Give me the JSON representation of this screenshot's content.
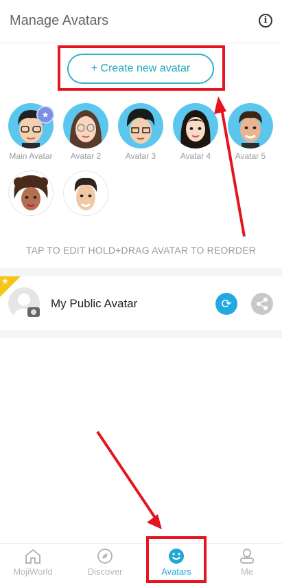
{
  "header": {
    "title": "Manage Avatars",
    "info_icon": "info-circle-icon"
  },
  "create_button": {
    "label": "+ Create new avatar"
  },
  "avatars": [
    {
      "label": "Main Avatar",
      "is_main": true
    },
    {
      "label": "Avatar 2"
    },
    {
      "label": "Avatar 3"
    },
    {
      "label": "Avatar 4"
    },
    {
      "label": "Avatar 5"
    },
    {
      "label": ""
    },
    {
      "label": ""
    }
  ],
  "hint": "TAP TO EDIT HOLD+DRAG AVATAR TO REORDER",
  "public_avatar": {
    "name": "My Public Avatar"
  },
  "nav": {
    "items": [
      {
        "label": "MojiWorld",
        "icon": "home-icon"
      },
      {
        "label": "Discover",
        "icon": "compass-icon"
      },
      {
        "label": "Avatars",
        "icon": "smiley-icon",
        "active": true
      },
      {
        "label": "Me",
        "icon": "person-icon"
      }
    ]
  },
  "colors": {
    "accent": "#1fa8b8",
    "nav_active": "#1fa8d6",
    "annotation": "#e5141e"
  }
}
